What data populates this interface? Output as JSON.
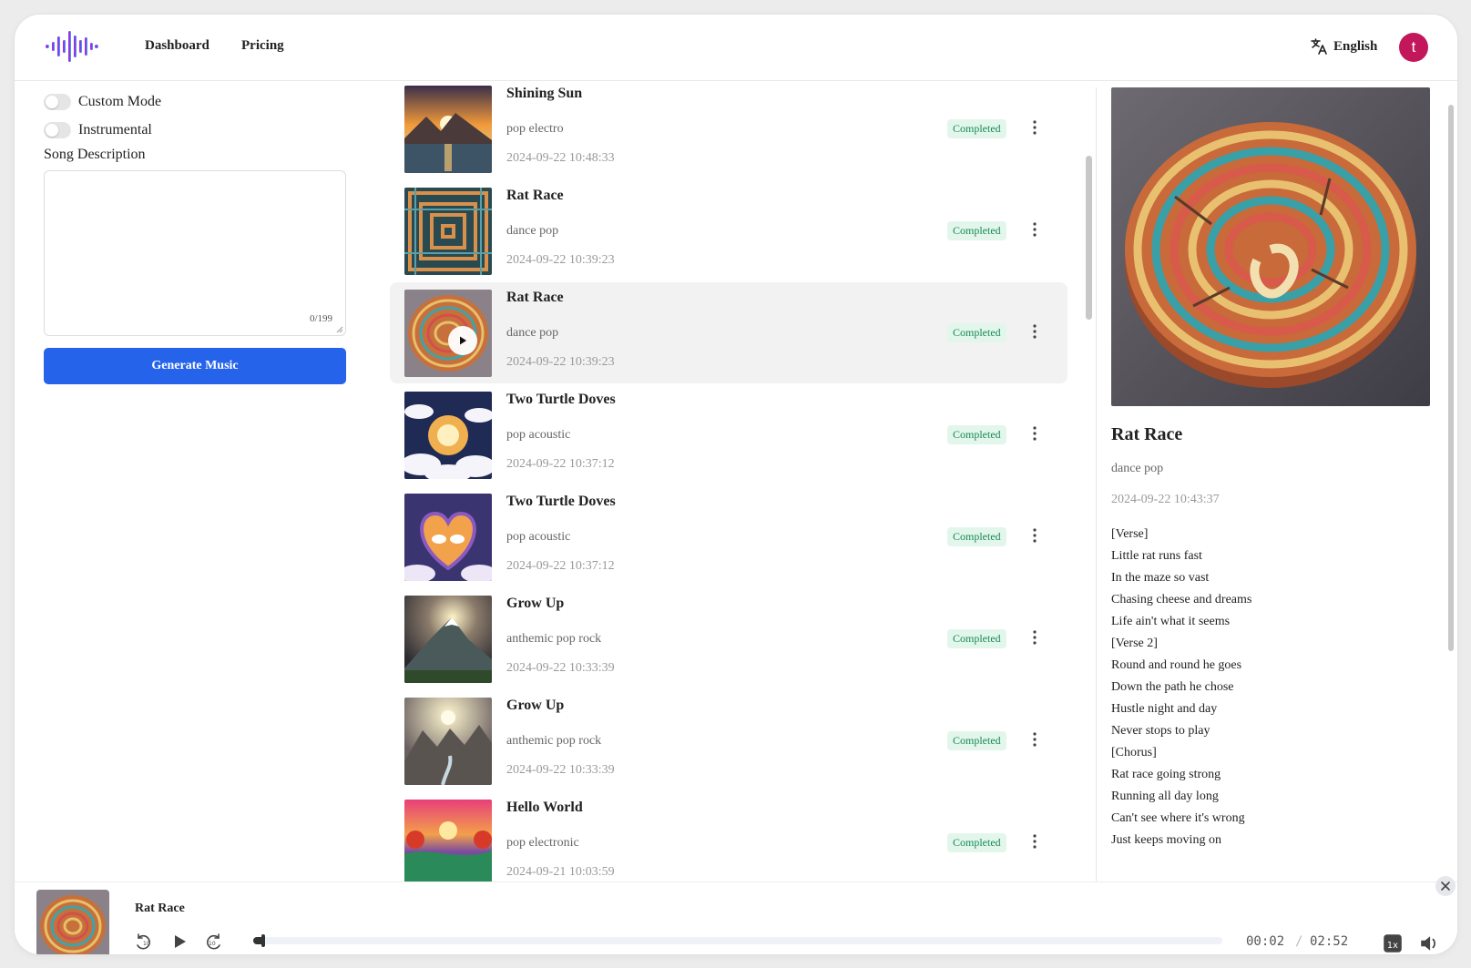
{
  "nav": {
    "dashboard": "Dashboard",
    "pricing": "Pricing"
  },
  "language": {
    "label": "English",
    "icon": "translate-icon"
  },
  "user": {
    "initial": "t",
    "avatar_color": "#c2185b"
  },
  "create_form": {
    "custom_mode_label": "Custom Mode",
    "instrumental_label": "Instrumental",
    "description_label": "Song Description",
    "description_value": "",
    "char_counter": "0/199",
    "generate_label": "Generate Music"
  },
  "songs": [
    {
      "title": "Shining Sun",
      "style": "pop electro",
      "date": "2024-09-22 10:48:33",
      "status": "Completed"
    },
    {
      "title": "Rat Race",
      "style": "dance pop",
      "date": "2024-09-22 10:39:23",
      "status": "Completed"
    },
    {
      "title": "Rat Race",
      "style": "dance pop",
      "date": "2024-09-22 10:39:23",
      "status": "Completed",
      "selected": true
    },
    {
      "title": "Two Turtle Doves",
      "style": "pop acoustic",
      "date": "2024-09-22 10:37:12",
      "status": "Completed"
    },
    {
      "title": "Two Turtle Doves",
      "style": "pop acoustic",
      "date": "2024-09-22 10:37:12",
      "status": "Completed"
    },
    {
      "title": "Grow Up",
      "style": "anthemic pop rock",
      "date": "2024-09-22 10:33:39",
      "status": "Completed"
    },
    {
      "title": "Grow Up",
      "style": "anthemic pop rock",
      "date": "2024-09-22 10:33:39",
      "status": "Completed"
    },
    {
      "title": "Hello World",
      "style": "pop electronic",
      "date": "2024-09-21 10:03:59",
      "status": "Completed"
    }
  ],
  "detail": {
    "title": "Rat Race",
    "style": "dance pop",
    "date": "2024-09-22 10:43:37",
    "lyrics": [
      "[Verse]",
      "Little rat runs fast",
      "In the maze so vast",
      "Chasing cheese and dreams",
      "Life ain't what it seems",
      "[Verse 2]",
      "Round and round he goes",
      "Down the path he chose",
      "Hustle night and day",
      "Never stops to play",
      "[Chorus]",
      "Rat race going strong",
      "Running all day long",
      "Can't see where it's wrong",
      "Just keeps moving on"
    ]
  },
  "player": {
    "title": "Rat Race",
    "current_time": "00:02",
    "separator": "/",
    "duration": "02:52",
    "progress_fraction": 0.012,
    "speed_icon": "1x-speed-icon",
    "volume_icon": "volume-icon"
  },
  "colors": {
    "primary": "#2563eb",
    "status_bg": "#e3f6ec",
    "status_text": "#188a55"
  }
}
